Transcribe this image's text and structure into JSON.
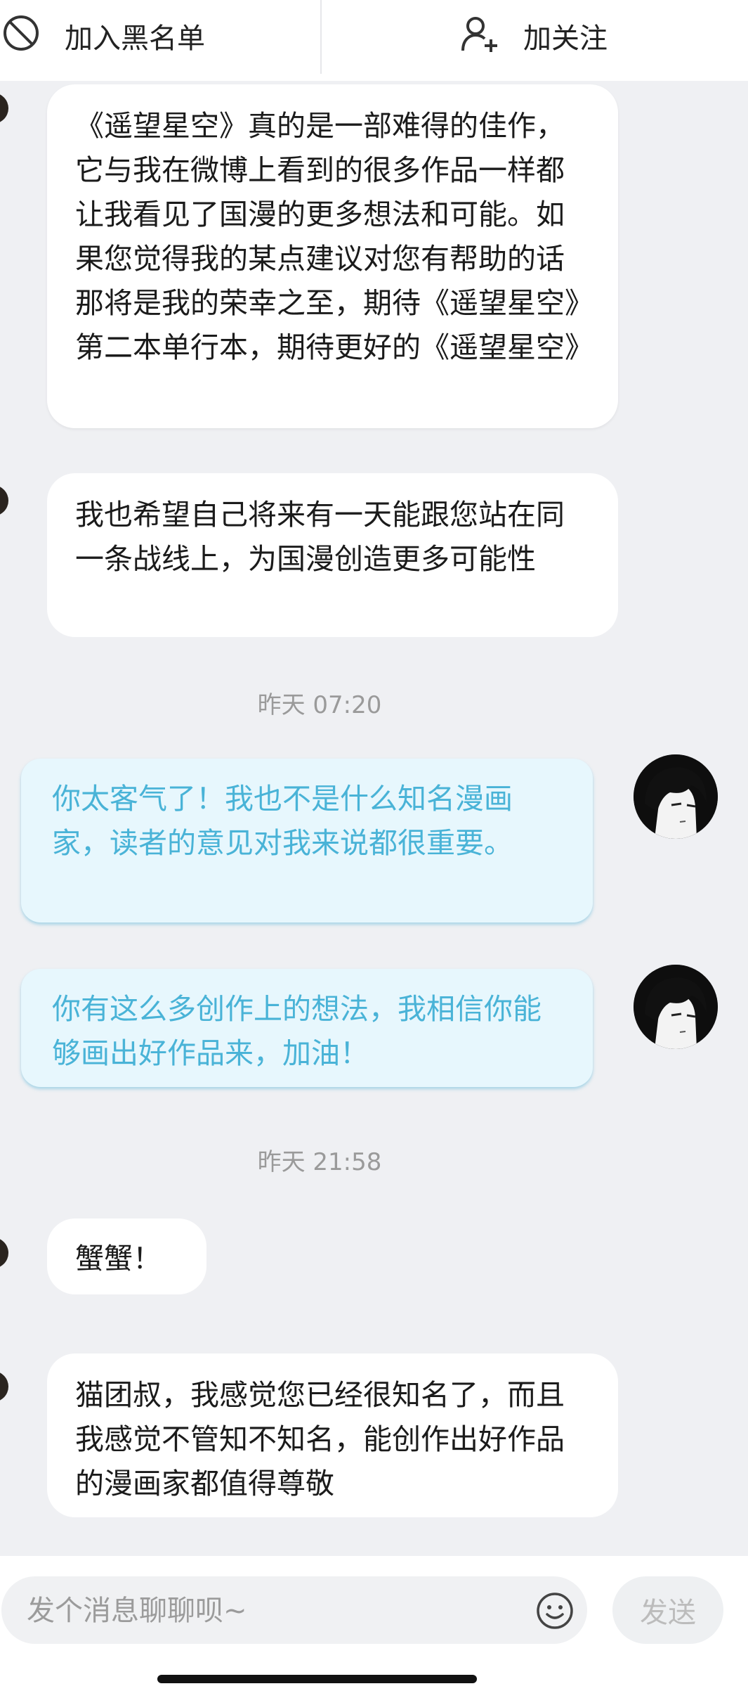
{
  "header": {
    "blacklist_label": "加入黑名单",
    "follow_label": "加关注"
  },
  "messages": [
    {
      "text": "《遥望星空》真的是一部难得的佳作，它与我在微博上看到的很多作品一样都让我看见了国漫的更多想法和可能。如果您觉得我的某点建议对您有帮助的话那将是我的荣幸之至，期待《遥望星空》第二本单行本，期待更好的《遥望星空》"
    },
    {
      "text": "我也希望自己将来有一天能跟您站在同一条战线上，为国漫创造更多可能性"
    },
    {
      "time": "昨天 07:20"
    },
    {
      "text": "你太客气了！我也不是什么知名漫画家，读者的意见对我来说都很重要。"
    },
    {
      "text": "你有这么多创作上的想法，我相信你能够画出好作品来，加油！"
    },
    {
      "time": "昨天 21:58"
    },
    {
      "text": "蟹蟹！"
    },
    {
      "text": "猫团叔，我感觉您已经很知名了，而且我感觉不管知不知名，能创作出好作品的漫画家都值得尊敬"
    }
  ],
  "composer": {
    "placeholder": "发个消息聊聊呗~",
    "send_label": "发送"
  },
  "icons": {
    "blacklist": "ban-icon",
    "follow": "add-user-icon",
    "emoji": "smiley-icon"
  },
  "colors": {
    "outgoing_text": "#49b3d7",
    "outgoing_bubble": "#e7f7fd"
  }
}
